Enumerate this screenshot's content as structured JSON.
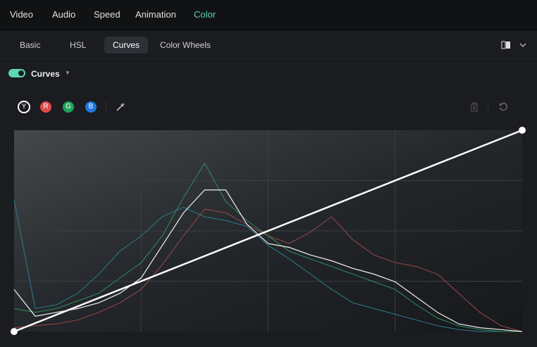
{
  "top_tabs": [
    "Video",
    "Audio",
    "Speed",
    "Animation",
    "Color"
  ],
  "active_top_tab": "Color",
  "sub_tabs": [
    "Basic",
    "HSL",
    "Curves",
    "Color Wheels"
  ],
  "active_sub_tab": "Curves",
  "section": {
    "label": "Curves",
    "enabled": true
  },
  "channels": [
    {
      "label": "Y",
      "color": "#1a1c20"
    },
    {
      "label": "R",
      "color": "#e04b4b"
    },
    {
      "label": "G",
      "color": "#1fa35a"
    },
    {
      "label": "B",
      "color": "#1f78e0"
    }
  ],
  "icons": [
    "eyedropper-icon",
    "trash-icon",
    "reset-icon",
    "compare-icon",
    "chevron-down-icon"
  ],
  "chart_data": {
    "type": "line",
    "curve": {
      "points": [
        [
          0,
          0
        ],
        [
          1,
          1
        ]
      ]
    },
    "histogram_x_count": 25,
    "series": [
      {
        "name": "Y",
        "color": "#f0f0f0",
        "values": [
          0.22,
          0.08,
          0.1,
          0.12,
          0.15,
          0.2,
          0.28,
          0.45,
          0.62,
          0.74,
          0.74,
          0.56,
          0.46,
          0.44,
          0.4,
          0.37,
          0.33,
          0.3,
          0.26,
          0.18,
          0.1,
          0.04,
          0.02,
          0.01,
          0.0
        ]
      },
      {
        "name": "G",
        "color": "#2f8f5c",
        "values": [
          0.12,
          0.1,
          0.12,
          0.16,
          0.2,
          0.28,
          0.36,
          0.5,
          0.7,
          0.88,
          0.68,
          0.58,
          0.5,
          0.42,
          0.38,
          0.34,
          0.3,
          0.26,
          0.22,
          0.14,
          0.07,
          0.03,
          0.01,
          0.0,
          0.0
        ]
      },
      {
        "name": "R",
        "color": "#9a4a48",
        "values": [
          0.02,
          0.03,
          0.04,
          0.06,
          0.1,
          0.15,
          0.22,
          0.35,
          0.5,
          0.64,
          0.62,
          0.56,
          0.5,
          0.46,
          0.52,
          0.6,
          0.48,
          0.4,
          0.36,
          0.34,
          0.3,
          0.2,
          0.1,
          0.03,
          0.0
        ]
      },
      {
        "name": "B",
        "color": "#2a7d8c",
        "values": [
          0.69,
          0.12,
          0.14,
          0.2,
          0.3,
          0.42,
          0.5,
          0.6,
          0.65,
          0.6,
          0.58,
          0.55,
          0.45,
          0.38,
          0.3,
          0.22,
          0.15,
          0.12,
          0.09,
          0.06,
          0.03,
          0.01,
          0.0,
          0.0,
          0.0
        ]
      }
    ]
  }
}
